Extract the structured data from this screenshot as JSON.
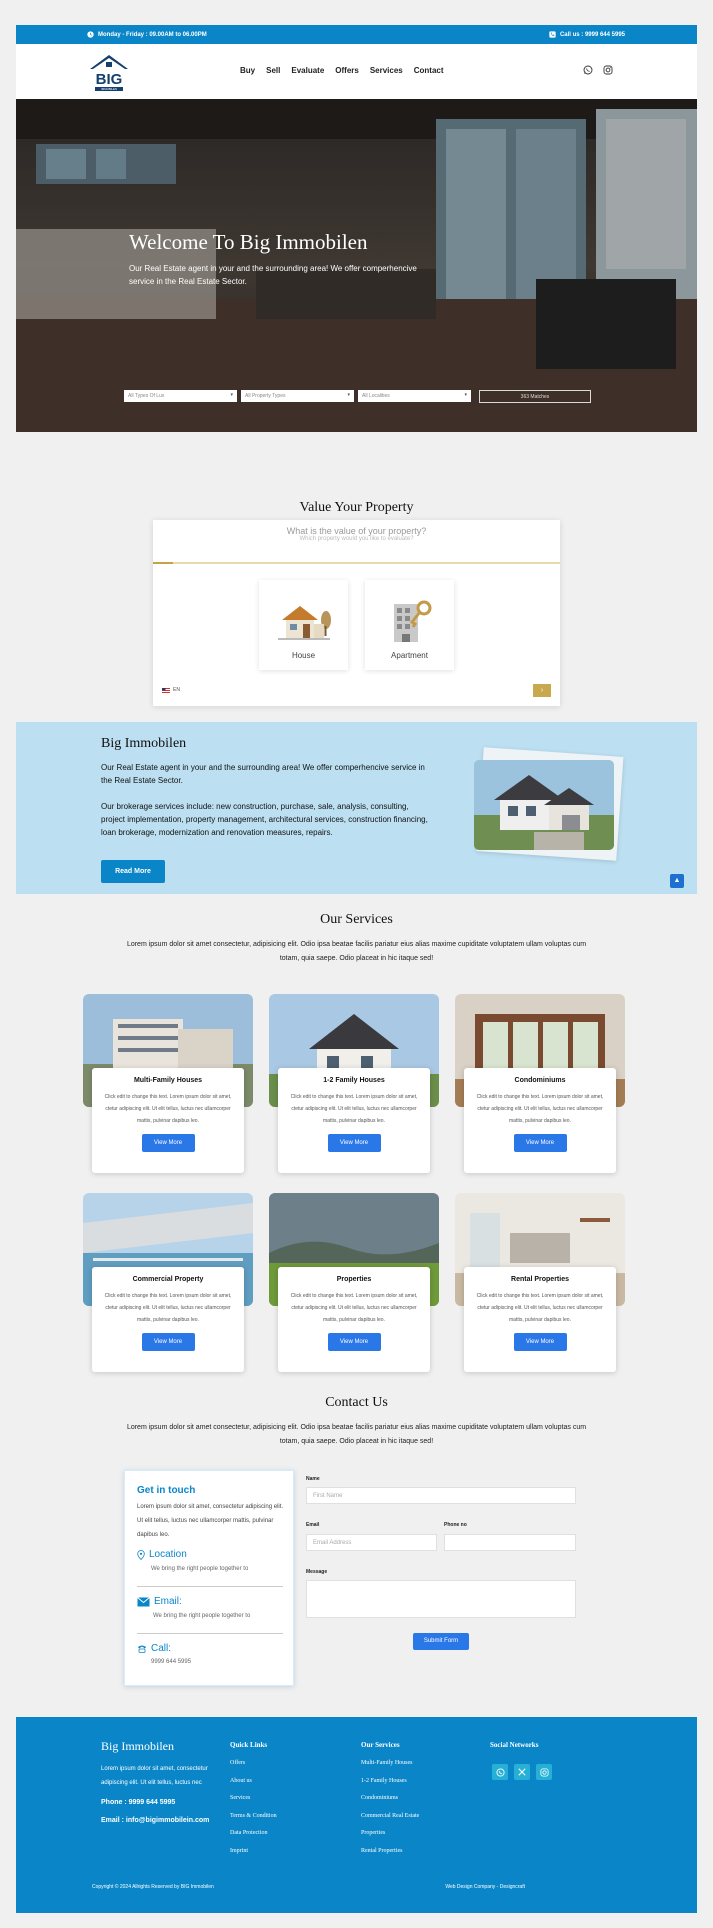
{
  "topbar": {
    "hours": "Monday - Friday : 09.00AM to 06.00PM",
    "phone": "Call us : 9999 644 5995"
  },
  "header": {
    "logo_text": "BIG",
    "logo_subtext": "IMMOBILEN",
    "nav": [
      "Buy",
      "Sell",
      "Evaluate",
      "Offers",
      "Services",
      "Contact"
    ]
  },
  "hero": {
    "title": "Welcome To Big Immobilen",
    "subtitle": "Our Real Estate agent in your and the surrounding area! We offer comperhencive service in the Real Estate Sector.",
    "filters": [
      "All Types Of Lux",
      "All Property Types",
      "All Localities"
    ],
    "search_button": "363 Matches"
  },
  "valuation": {
    "title": "Value Your Property",
    "question": "What is the value of your property?",
    "hint": "Which property would you like to evaluate?",
    "options": [
      "House",
      "Apartment"
    ],
    "language": "EN",
    "next": "›"
  },
  "about": {
    "title": "Big Immobilen",
    "para1": "Our Real Estate agent in your and the surrounding area! We offer comperhencive service in the Real Estate Sector.",
    "para2": "Our brokerage services include: new construction, purchase, sale, analysis, consulting, project implementation, property management, architectural services, construction financing, loan brokerage, modernization and renovation measures, repairs.",
    "button": "Read More",
    "to_top": "▲"
  },
  "services": {
    "title": "Our Services",
    "description": "Lorem ipsum dolor sit amet consectetur, adipisicing elit. Odio ipsa beatae facilis pariatur eius alias maxime cupiditate voluptatem ullam voluptas cum totam, quia saepe. Odio placeat in hic itaque sed!",
    "card_text": "Click edit to change this text. Lorem ipsum dolor sit amet, ctetur adipiscing elit. Ut elit tellus, luctus nec ullamcorper mattis, pulvinar dapibus leo.",
    "button": "View More",
    "items": [
      {
        "title": "Multi-Family Houses"
      },
      {
        "title": "1-2 Family Houses"
      },
      {
        "title": "Condominiums"
      },
      {
        "title": "Commercial Property"
      },
      {
        "title": "Properties"
      },
      {
        "title": "Rental Properties"
      }
    ]
  },
  "contact": {
    "title": "Contact Us",
    "description": "Lorem ipsum dolor sit amet consectetur, adipisicing elit. Odio ipsa beatae facilis pariatur eius alias maxime cupiditate voluptatem ullam voluptas cum totam, quia saepe. Odio placeat in hic itaque sed!",
    "info": {
      "title": "Get in touch",
      "text": "Lorem ipsum dolor sit amet, consectetur adipiscing elit. Ut elit tellus, luctus nec ullamcorper mattis, pulvinar dapibus leo.",
      "location_label": "Location",
      "location_text": "We bring the right people together to",
      "email_label": "Email:",
      "email_text": "We bring the right people together to",
      "call_label": "Call:",
      "call_text": "9999 644 5995"
    },
    "form": {
      "name_label": "Name",
      "name_placeholder": "First Name",
      "email_label": "Email",
      "email_placeholder": "Email Address",
      "phone_label": "Phone no",
      "message_label": "Message",
      "submit": "Submit Form"
    }
  },
  "footer": {
    "brand": "Big Immobilen",
    "text": "Lorem ipsum dolor sit amet, consectetur adipiscing elit. Ut elit tellus, luctus nec",
    "phone": "Phone : 9999 644 5995",
    "email": "Email : info@bigimmobilein.com",
    "quick_links_title": "Quick Links",
    "quick_links": [
      "Offers",
      "About us",
      "Services",
      "Terms & Condition",
      "Data Protection",
      "Imprint"
    ],
    "services_title": "Our Services",
    "services_links": [
      "Multi-Family Houses",
      "1-2 Family Houses",
      "Condominiums",
      "Commercial Real Estate",
      "Properties",
      "Rental Properties"
    ],
    "social_title": "Social Networks",
    "copyright": "Copyright © 2024 Allrights Reserved by BIG Immobilen",
    "credit": "Web Design Company - Designcraft"
  },
  "colors": {
    "primary": "#0a86c8",
    "about_bg": "#bcdff2",
    "button_blue": "#2a77e8",
    "gold": "#c9a94e"
  }
}
